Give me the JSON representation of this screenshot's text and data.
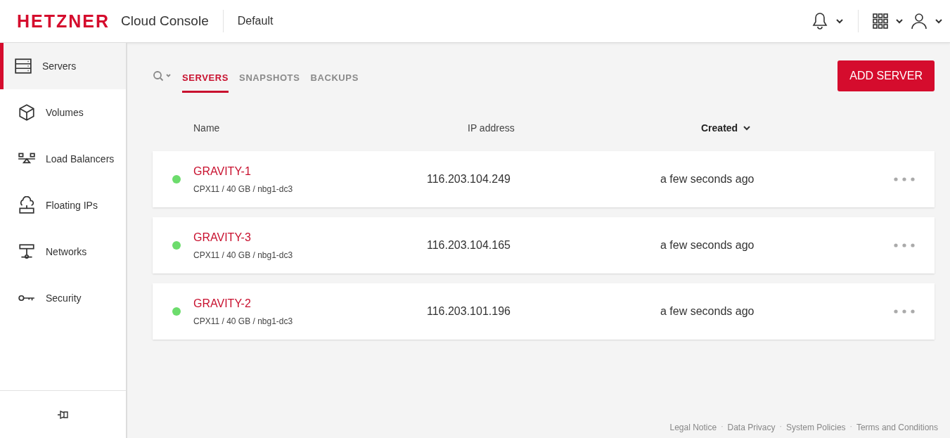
{
  "header": {
    "logo": "HETZNER",
    "app_name": "Cloud Console",
    "project": "Default"
  },
  "sidebar": {
    "items": [
      {
        "label": "Servers",
        "kind": "server",
        "selected": true
      },
      {
        "label": "Volumes",
        "kind": "cube",
        "selected": false
      },
      {
        "label": "Load Balancers",
        "kind": "balancer",
        "selected": false
      },
      {
        "label": "Floating IPs",
        "kind": "cloud",
        "selected": false
      },
      {
        "label": "Networks",
        "kind": "network",
        "selected": false
      },
      {
        "label": "Security",
        "kind": "key",
        "selected": false
      }
    ]
  },
  "tabs": [
    {
      "label": "SERVERS",
      "selected": true
    },
    {
      "label": "SNAPSHOTS",
      "selected": false
    },
    {
      "label": "BACKUPS",
      "selected": false
    }
  ],
  "add_button": "ADD SERVER",
  "table": {
    "columns": [
      {
        "label": "Name",
        "sorted": false
      },
      {
        "label": "IP address",
        "sorted": false
      },
      {
        "label": "Created",
        "sorted": true
      }
    ],
    "rows": [
      {
        "name": "GRAVITY-1",
        "spec": "CPX11 / 40 GB / nbg1-dc3",
        "ip": "116.203.104.249",
        "created": "a few seconds ago",
        "color": "#6cdc6c"
      },
      {
        "name": "GRAVITY-3",
        "spec": "CPX11 / 40 GB / nbg1-dc3",
        "ip": "116.203.104.165",
        "created": "a few seconds ago",
        "color": "#6cdc6c"
      },
      {
        "name": "GRAVITY-2",
        "spec": "CPX11 / 40 GB / nbg1-dc3",
        "ip": "116.203.101.196",
        "created": "a few seconds ago",
        "color": "#6cdc6c"
      }
    ]
  },
  "footer": [
    {
      "kind": "link",
      "text": "Legal Notice"
    },
    {
      "kind": "separator",
      "text": "·"
    },
    {
      "kind": "link",
      "text": "Data Privacy"
    },
    {
      "kind": "separator",
      "text": "·"
    },
    {
      "kind": "link",
      "text": "System Policies"
    },
    {
      "kind": "separator",
      "text": "·"
    },
    {
      "kind": "link",
      "text": "Terms and Conditions"
    }
  ]
}
